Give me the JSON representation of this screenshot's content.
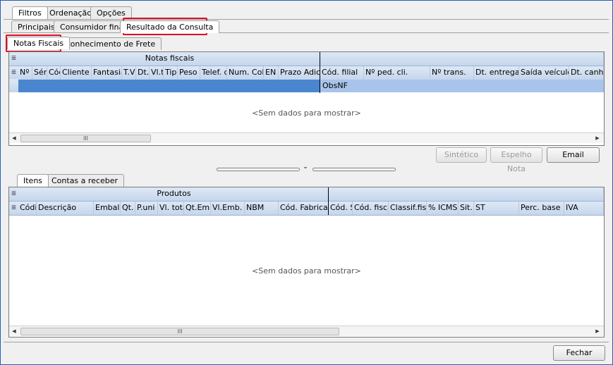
{
  "tabs_top": [
    "Filtros",
    "Ordenação",
    "Opções"
  ],
  "tabs_second": [
    "Principais",
    "Consumidor final",
    "Resultado da Consulta"
  ],
  "tabs_third": [
    "Notas Fiscais",
    "Conhecimento de Frete"
  ],
  "nf_grid": {
    "band_left": "Notas fiscais",
    "columns_left": [
      "Nº",
      "Sér",
      "Cód",
      "Cliente",
      "Fantasia",
      "T.V",
      "Dt.",
      "Vl.t",
      "Tip",
      "Peso",
      "Telef. c",
      "Num. Col",
      "EN",
      "Prazo Adic"
    ],
    "columns_right": [
      "Cód. filial",
      "Nº ped. cli.",
      "Nº trans.",
      "Dt. entrega",
      "Saída veículo",
      "Dt. canho"
    ],
    "subrow_right": "ObsNF",
    "empty_text": "<Sem dados para mostrar>",
    "scroll_thumb": "III"
  },
  "buttons_mid": {
    "sintetico": "Sintético",
    "espelho": "Espelho Nota",
    "email": "Email"
  },
  "tabs_bottom": [
    "Itens",
    "Contas a receber"
  ],
  "items_grid": {
    "band_left": "Produtos",
    "columns_left": [
      "Códi",
      "Descrição",
      "Embala",
      "Qt.",
      "P.uni",
      "Vl. tota",
      "Qt.Emb",
      "Vl.Emb.",
      "NBM",
      "Cód. Fabricar"
    ],
    "columns_right": [
      "Cód. S",
      "Cód. fisca",
      "Classif.fis",
      "% ICMS",
      "Sit.",
      "ST",
      "Perc. base r",
      "IVA"
    ],
    "empty_text": "<Sem dados para mostrar>",
    "scroll_thumb": "III"
  },
  "close_button": "Fechar"
}
